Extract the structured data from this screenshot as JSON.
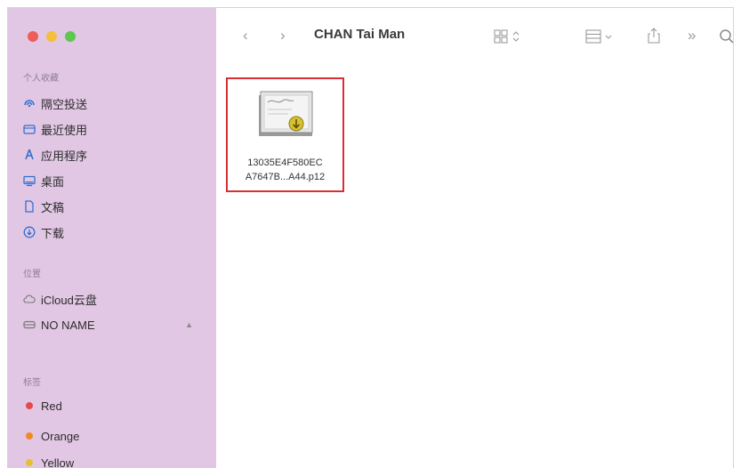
{
  "window": {
    "title": "CHAN Tai Man"
  },
  "colors": {
    "close": "#ee5e58",
    "minimize": "#f4bf3a",
    "zoom": "#5cc84d",
    "accent": "#2f6fd1",
    "selection_border": "#d82f35"
  },
  "sidebar": {
    "favorites_title": "个人收藏",
    "favorites": [
      {
        "label": "隔空投送",
        "icon": "airdrop-icon"
      },
      {
        "label": "最近使用",
        "icon": "recents-icon"
      },
      {
        "label": "应用程序",
        "icon": "applications-icon"
      },
      {
        "label": "桌面",
        "icon": "desktop-icon"
      },
      {
        "label": "文稿",
        "icon": "documents-icon"
      },
      {
        "label": "下载",
        "icon": "downloads-icon"
      }
    ],
    "locations_title": "位置",
    "locations": [
      {
        "label": "iCloud云盘",
        "icon": "icloud-icon"
      },
      {
        "label": "NO NAME",
        "icon": "drive-icon",
        "eject": "▲"
      }
    ],
    "tags_title": "标签",
    "tags": [
      {
        "label": "Red",
        "color": "#e34a4a"
      },
      {
        "label": "Orange",
        "color": "#f08a24"
      },
      {
        "label": "Yellow",
        "color": "#e8bf2e"
      }
    ]
  },
  "toolbar": {
    "back": "‹",
    "forward": "›",
    "more": "»"
  },
  "files": [
    {
      "name_line1": "13035E4F580EC",
      "name_line2": "A7647B...A44.p12",
      "icon": "certificate-icon"
    }
  ]
}
